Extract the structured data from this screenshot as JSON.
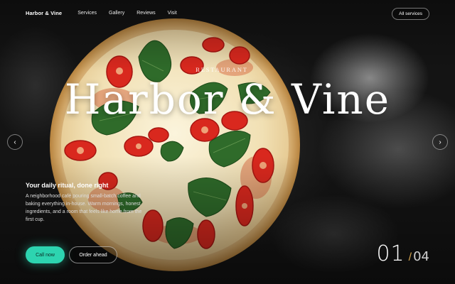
{
  "nav": {
    "brand": "Harbor & Vine",
    "links": [
      "Services",
      "Gallery",
      "Reviews",
      "Visit"
    ],
    "cta": "All services"
  },
  "hero": {
    "eyebrow": "RESTAURANT",
    "title": "Harbor & Vine",
    "tagline": "Your daily ritual, done right",
    "description": "A neighborhood café pouring small-batch coffee and baking everything in-house. Warm mornings, honest ingredients, and a room that feels like home from the first cup.",
    "primary_button": "Call now",
    "secondary_button": "Order ahead"
  },
  "slider": {
    "prev_icon": "chevron-left-icon",
    "next_icon": "chevron-right-icon",
    "current": "01",
    "separator": "/",
    "total": "04"
  },
  "colors": {
    "accent": "#2dd4b0",
    "separator_accent": "#d2a24c"
  }
}
